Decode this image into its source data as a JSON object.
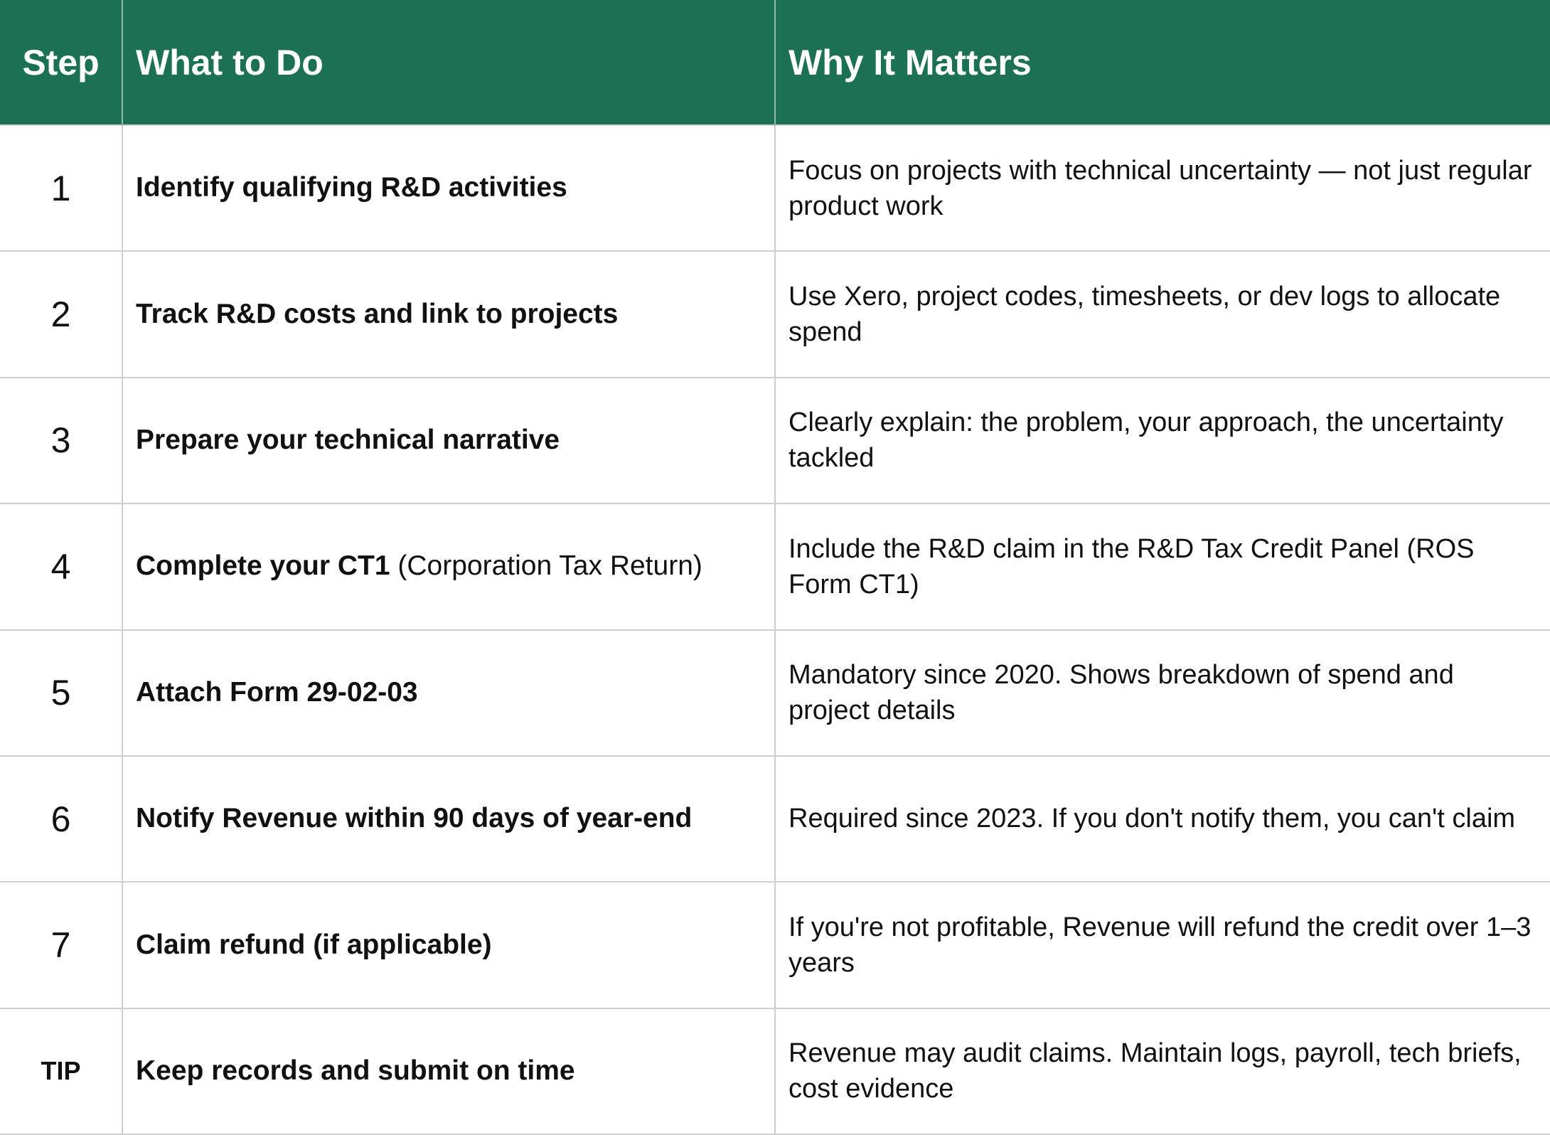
{
  "headers": {
    "step": "Step",
    "what": "What to Do",
    "why": "Why It Matters"
  },
  "rows": [
    {
      "step": "1",
      "what": "Identify qualifying R&D activities",
      "what_note": "",
      "why": "Focus on projects with technical uncertainty — not just regular product work"
    },
    {
      "step": "2",
      "what": "Track R&D costs and link to projects",
      "what_note": "",
      "why": "Use Xero, project codes, timesheets, or dev logs to allocate spend"
    },
    {
      "step": "3",
      "what": "Prepare your technical narrative",
      "what_note": "",
      "why": "Clearly explain: the problem, your approach, the uncertainty tackled"
    },
    {
      "step": "4",
      "what": "Complete your CT1",
      "what_note": "(Corporation Tax Return)",
      "why": "Include the R&D claim in the R&D Tax Credit Panel (ROS Form CT1)"
    },
    {
      "step": "5",
      "what": "Attach Form 29-02-03",
      "what_note": "",
      "why": "Mandatory since 2020. Shows breakdown of spend and project details"
    },
    {
      "step": "6",
      "what": "Notify Revenue within 90 days of year-end",
      "what_note": "",
      "why": "Required since 2023. If you don't notify them, you can't claim"
    },
    {
      "step": "7",
      "what": "Claim refund (if applicable)",
      "what_note": "",
      "why": "If you're not profitable, Revenue will refund the credit over 1–3 years"
    },
    {
      "step": "TIP",
      "what": "Keep records and submit on time",
      "what_note": "",
      "why": "Revenue may audit claims. Maintain logs, payroll, tech briefs, cost evidence"
    }
  ],
  "colors": {
    "header_bg": "#1c7155",
    "header_text": "#ffffff",
    "grid": "#cfcfcf"
  }
}
